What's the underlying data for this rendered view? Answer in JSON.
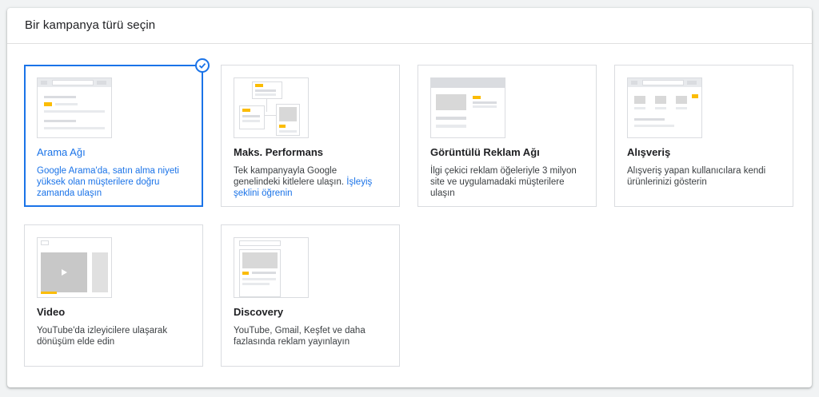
{
  "header": {
    "title": "Bir kampanya türü seçin"
  },
  "cards": [
    {
      "id": "search",
      "title": "Arama Ağı",
      "description": "Google Arama'da, satın alma niyeti yüksek olan müşterilere doğru zamanda ulaşın",
      "selected": true
    },
    {
      "id": "pmax",
      "title": "Maks. Performans",
      "description": "Tek kampanyayla Google genelindeki kitlelere ulaşın.",
      "link": "İşleyiş şeklini öğrenin",
      "selected": false
    },
    {
      "id": "display",
      "title": "Görüntülü Reklam Ağı",
      "description": "İlgi çekici reklam öğeleriyle 3 milyon site ve uygulamadaki müşterilere ulaşın",
      "selected": false
    },
    {
      "id": "shopping",
      "title": "Alışveriş",
      "description": "Alışveriş yapan kullanıcılara kendi ürünlerinizi gösterin",
      "selected": false
    },
    {
      "id": "video",
      "title": "Video",
      "description": "YouTube'da izleyicilere ulaşarak dönüşüm elde edin",
      "selected": false
    },
    {
      "id": "discovery",
      "title": "Discovery",
      "description": "YouTube, Gmail, Keşfet ve daha fazlasında reklam yayınlayın",
      "selected": false
    }
  ],
  "icons": {
    "selected": "check-circle-icon",
    "play": "play-icon"
  },
  "colors": {
    "accent": "#1a73e8",
    "highlight": "#fbbc04",
    "border": "#dadce0"
  }
}
